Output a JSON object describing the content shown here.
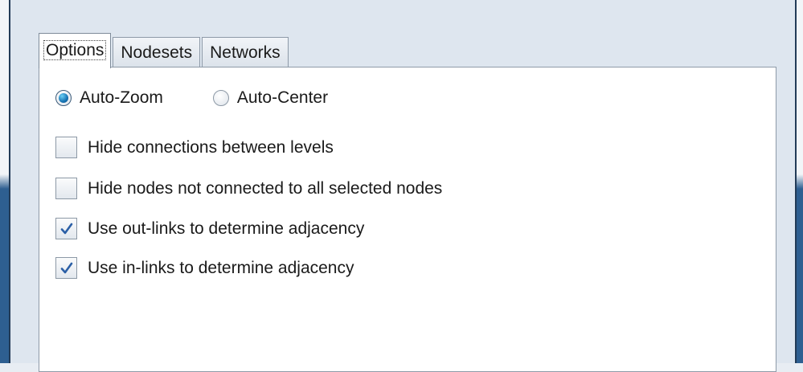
{
  "tabs": [
    {
      "label": "Options",
      "active": true
    },
    {
      "label": "Nodesets",
      "active": false
    },
    {
      "label": "Networks",
      "active": false
    }
  ],
  "view_mode": {
    "options": [
      {
        "label": "Auto-Zoom",
        "selected": true
      },
      {
        "label": "Auto-Center",
        "selected": false
      }
    ]
  },
  "checkboxes": [
    {
      "label": "Hide connections between levels",
      "checked": false
    },
    {
      "label": "Hide nodes not connected to all selected nodes",
      "checked": false
    },
    {
      "label": "Use out-links to determine adjacency",
      "checked": true
    },
    {
      "label": "Use in-links to determine adjacency",
      "checked": true
    }
  ],
  "colors": {
    "accent": "#1673b3",
    "check_mark": "#2b5fa6",
    "window_border": "#2e5f91"
  },
  "icons": {
    "radio_selected": "radio-selected-icon",
    "check": "checkmark-icon"
  }
}
